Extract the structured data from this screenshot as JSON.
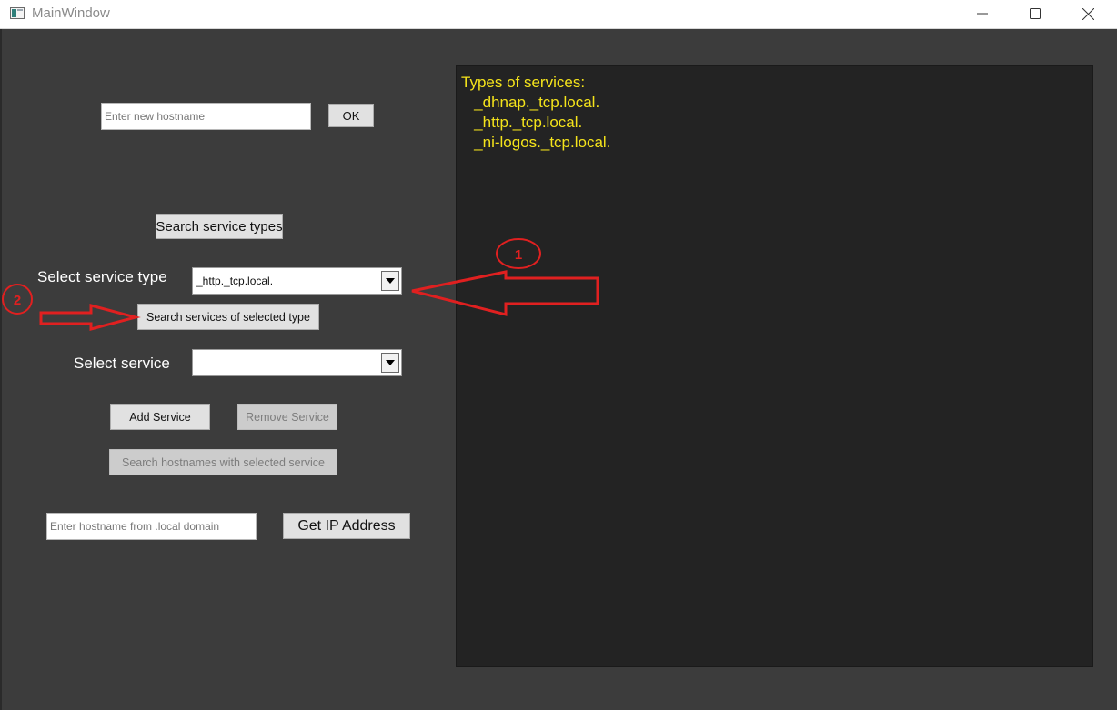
{
  "window": {
    "title": "MainWindow"
  },
  "hostname": {
    "placeholder": "Enter new hostname",
    "ok_label": "OK"
  },
  "search_types_label": "Search service types",
  "service_type": {
    "label": "Select service type",
    "selected": "_http._tcp.local."
  },
  "search_services_label": "Search services of selected type",
  "service": {
    "label": "Select service",
    "selected": ""
  },
  "buttons": {
    "add_service": "Add Service",
    "remove_service": "Remove Service",
    "search_hostnames": "Search hostnames with selected service",
    "get_ip": "Get IP Address"
  },
  "local_hostname": {
    "placeholder": "Enter hostname from .local domain"
  },
  "output": {
    "heading": "Types of services:",
    "lines": [
      "   _dhnap._tcp.local.",
      "   _http._tcp.local.",
      "   _ni-logos._tcp.local."
    ]
  },
  "annotations": {
    "marker_1": "1",
    "marker_2": "2",
    "color": "#e02020"
  },
  "colors": {
    "background": "#3c3c3c",
    "panel": "#232323",
    "output_text": "#f4e31b"
  }
}
